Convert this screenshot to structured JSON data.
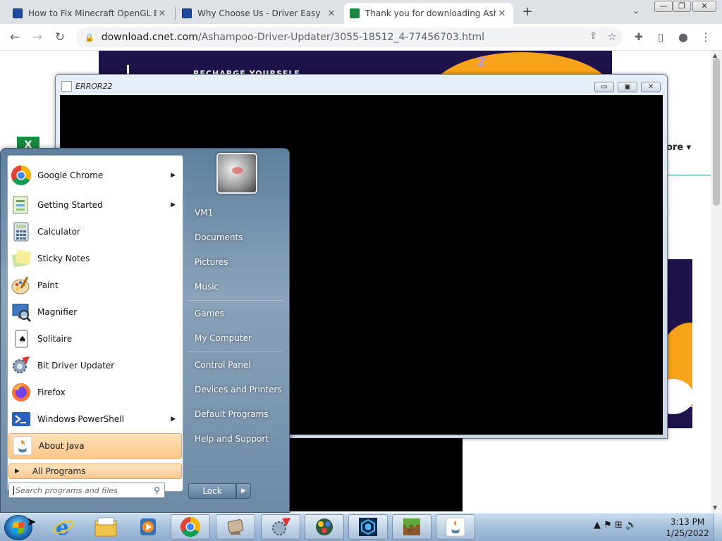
{
  "browser": {
    "tabs": [
      {
        "title": "How to Fix Minecraft OpenGL Erro",
        "favicon": "driver-easy-icon",
        "active": false
      },
      {
        "title": "Why Choose Us - Driver Easy",
        "favicon": "driver-easy-icon",
        "active": false
      },
      {
        "title": "Thank you for downloading Ashamp",
        "favicon": "cnet-download-icon",
        "active": true
      }
    ],
    "new_tab_symbol": "+",
    "tab_close_symbol": "✕",
    "tab_search_symbol": "⌄",
    "window_controls": {
      "minimize": "—",
      "restore": "❐",
      "close": "✕"
    },
    "url": {
      "host": "download.cnet.com",
      "path": "/Ashampoo-Driver-Updater/3055-18512_4-77456703.html"
    },
    "nav_symbols": {
      "back": "←",
      "forward": "→",
      "reload": "↻"
    },
    "toolbar_icons": {
      "share": "⇪",
      "bookmark": "☆",
      "extensions": "✚",
      "sidebar": "▯",
      "profile": "●",
      "menu": "⋮"
    }
  },
  "webpage": {
    "banner_text": "RECHARGE YOURSELF",
    "banner_z": "Z",
    "logo_letter": "X",
    "more_label": "ore ▾"
  },
  "java_window": {
    "title": "ERROR22",
    "controls": {
      "minimize": "▭",
      "maximize": "▣",
      "close": "✕"
    }
  },
  "start_menu": {
    "programs": [
      {
        "label": "Google Chrome",
        "icon": "chrome-icon",
        "has_submenu": true
      },
      {
        "label": "Getting Started",
        "icon": "getting-started-icon",
        "has_submenu": true
      },
      {
        "label": "Calculator",
        "icon": "calculator-icon",
        "has_submenu": false
      },
      {
        "label": "Sticky Notes",
        "icon": "sticky-notes-icon",
        "has_submenu": false
      },
      {
        "label": "Paint",
        "icon": "paint-icon",
        "has_submenu": false
      },
      {
        "label": "Magnifier",
        "icon": "magnifier-icon",
        "has_submenu": false
      },
      {
        "label": "Solitaire",
        "icon": "solitaire-icon",
        "has_submenu": false
      },
      {
        "label": "Bit Driver Updater",
        "icon": "bit-driver-updater-icon",
        "has_submenu": false
      },
      {
        "label": "Firefox",
        "icon": "firefox-icon",
        "has_submenu": false
      },
      {
        "label": "Windows PowerShell",
        "icon": "powershell-icon",
        "has_submenu": true
      },
      {
        "label": "About Java",
        "icon": "java-icon",
        "has_submenu": false,
        "highlighted": true
      }
    ],
    "all_programs": "All Programs",
    "search_placeholder": "Search programs and files",
    "right_links": [
      {
        "label": "VM1"
      },
      {
        "label": "Documents"
      },
      {
        "label": "Pictures"
      },
      {
        "label": "Music"
      },
      {
        "label": "Games"
      },
      {
        "label": "My Computer"
      },
      {
        "label": "Control Panel"
      },
      {
        "label": "Devices and Printers"
      },
      {
        "label": "Default Programs"
      },
      {
        "label": "Help and Support"
      }
    ],
    "lock_label": "Lock",
    "lock_arrow": "▶"
  },
  "taskbar": {
    "pinned": [
      {
        "name": "internet-explorer-icon",
        "open": false
      },
      {
        "name": "file-explorer-icon",
        "open": false
      },
      {
        "name": "media-player-icon",
        "open": false
      },
      {
        "name": "chrome-icon",
        "open": true
      },
      {
        "name": "unknown-app-icon",
        "open": true
      },
      {
        "name": "bit-driver-updater-icon",
        "open": true
      },
      {
        "name": "solitaire-app-icon",
        "open": true
      },
      {
        "name": "cube-app-icon",
        "open": true
      },
      {
        "name": "minecraft-icon",
        "open": true
      },
      {
        "name": "java-icon",
        "open": true
      }
    ],
    "tray_symbols": "▲  ⚑  ⊞  🔈",
    "time": "3:13 PM",
    "date": "1/25/2022"
  }
}
